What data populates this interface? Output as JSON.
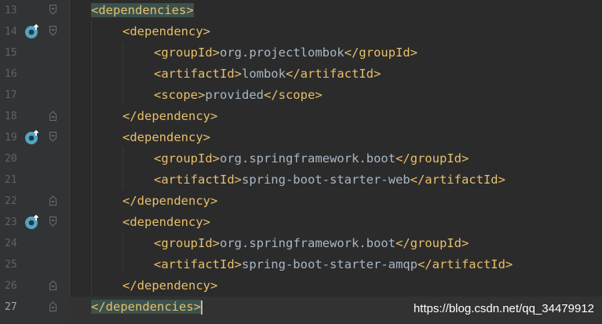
{
  "colors": {
    "background": "#2b2b2b",
    "gutter": "#313335",
    "tag": "#e8bf6a",
    "text": "#a9b7c6",
    "line_number": "#606366",
    "matched_tag_highlight": "#3b514d",
    "run_icon": "#4fa6c7"
  },
  "lines": [
    {
      "num": "13",
      "open": "<dependencies>",
      "text": "",
      "close": "",
      "gutter_icon": "",
      "fold": "open"
    },
    {
      "num": "14",
      "open": "<dependency>",
      "text": "",
      "close": "",
      "gutter_icon": "overridden-method-icon",
      "fold": "open"
    },
    {
      "num": "15",
      "open": "<groupId>",
      "text": "org.projectlombok",
      "close": "</groupId>",
      "gutter_icon": "",
      "fold": ""
    },
    {
      "num": "16",
      "open": "<artifactId>",
      "text": "lombok",
      "close": "</artifactId>",
      "gutter_icon": "",
      "fold": ""
    },
    {
      "num": "17",
      "open": "<scope>",
      "text": "provided",
      "close": "</scope>",
      "gutter_icon": "",
      "fold": ""
    },
    {
      "num": "18",
      "open": "",
      "text": "",
      "close": "</dependency>",
      "gutter_icon": "",
      "fold": "close"
    },
    {
      "num": "19",
      "open": "<dependency>",
      "text": "",
      "close": "",
      "gutter_icon": "overridden-method-icon",
      "fold": "open"
    },
    {
      "num": "20",
      "open": "<groupId>",
      "text": "org.springframework.boot",
      "close": "</groupId>",
      "gutter_icon": "",
      "fold": ""
    },
    {
      "num": "21",
      "open": "<artifactId>",
      "text": "spring-boot-starter-web",
      "close": "</artifactId>",
      "gutter_icon": "",
      "fold": ""
    },
    {
      "num": "22",
      "open": "",
      "text": "",
      "close": "</dependency>",
      "gutter_icon": "",
      "fold": "close"
    },
    {
      "num": "23",
      "open": "<dependency>",
      "text": "",
      "close": "",
      "gutter_icon": "overridden-method-icon",
      "fold": "open"
    },
    {
      "num": "24",
      "open": "<groupId>",
      "text": "org.springframework.boot",
      "close": "</groupId>",
      "gutter_icon": "",
      "fold": ""
    },
    {
      "num": "25",
      "open": "<artifactId>",
      "text": "spring-boot-starter-amqp",
      "close": "</artifactId>",
      "gutter_icon": "",
      "fold": ""
    },
    {
      "num": "26",
      "open": "",
      "text": "",
      "close": "</dependency>",
      "gutter_icon": "",
      "fold": "close"
    },
    {
      "num": "27",
      "open": "",
      "text": "",
      "close": "</dependencies>",
      "gutter_icon": "",
      "fold": "close"
    }
  ],
  "watermark": "https://blog.csdn.net/qq_34479912"
}
